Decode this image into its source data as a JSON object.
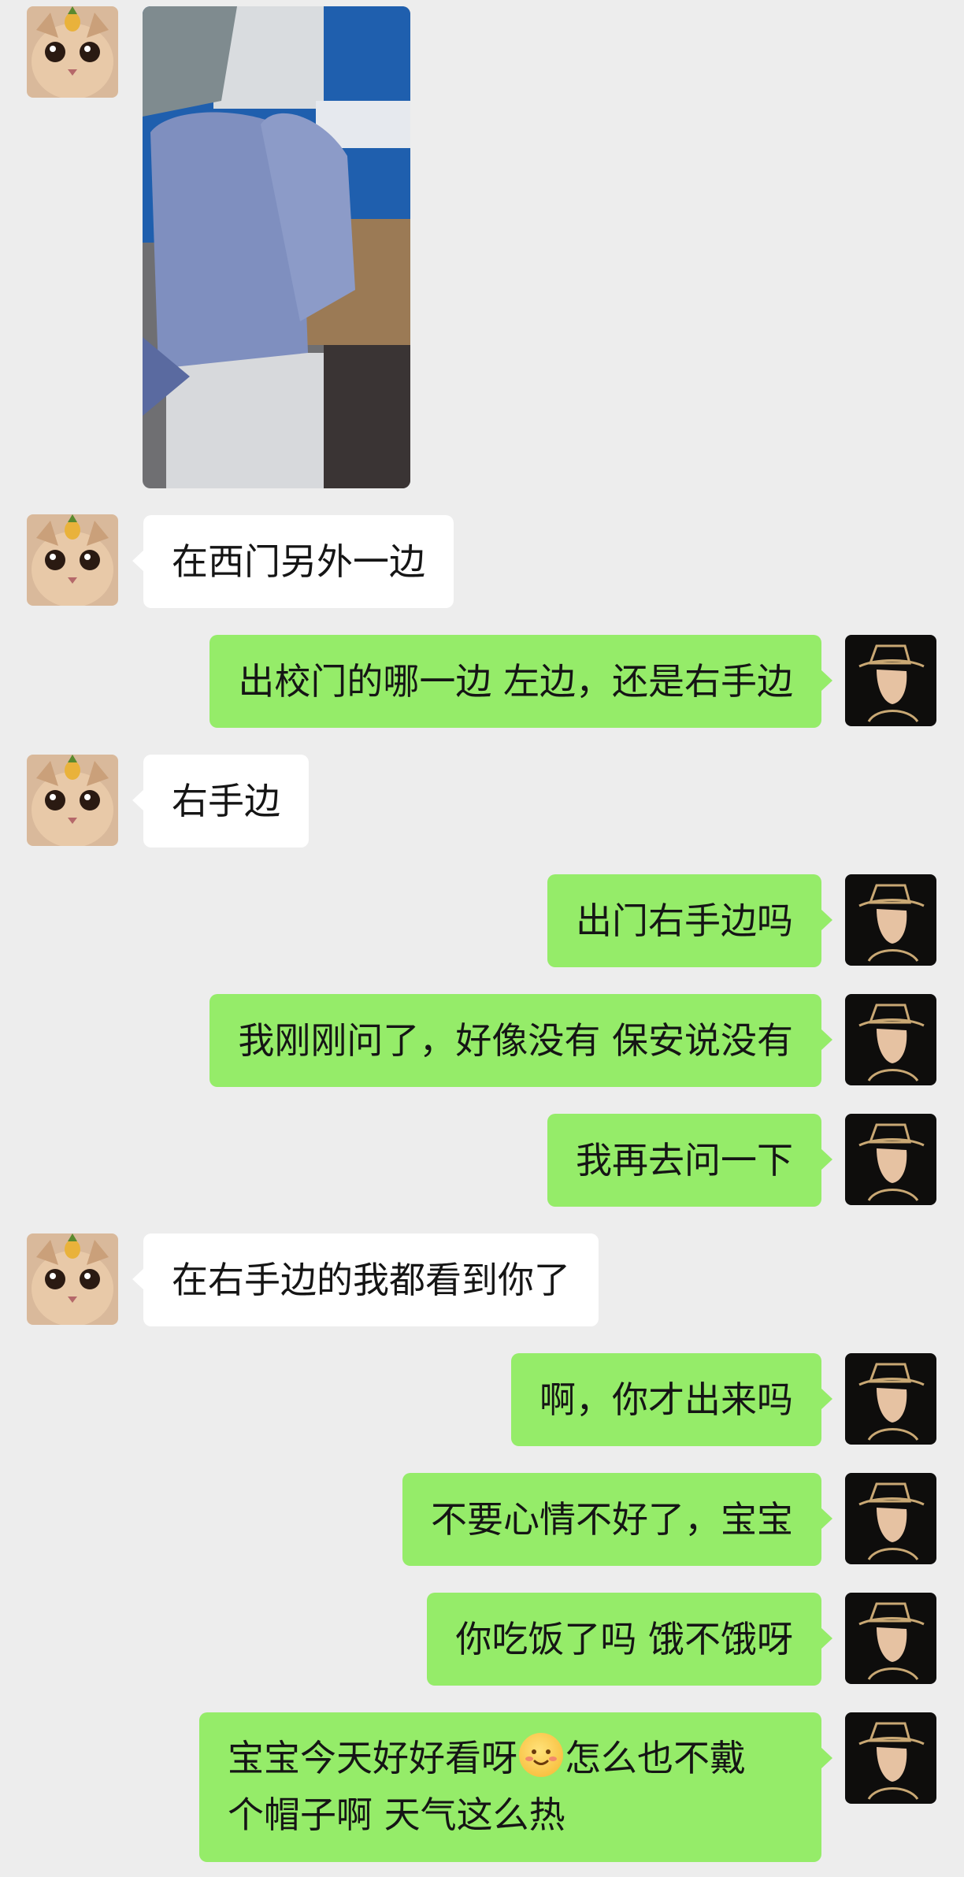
{
  "contacts": {
    "other": {
      "avatar_icon": "cat-with-pineapple-avatar"
    },
    "me": {
      "avatar_icon": "hat-man-sketch-avatar"
    }
  },
  "messages": [
    {
      "side": "left",
      "type": "image",
      "image_icon": "photo-bags-on-stool"
    },
    {
      "side": "left",
      "type": "text",
      "text": "在西门另外一边"
    },
    {
      "side": "right",
      "type": "text",
      "text": "出校门的哪一边 左边，还是右手边"
    },
    {
      "side": "left",
      "type": "text",
      "text": "右手边"
    },
    {
      "side": "right",
      "type": "text",
      "text": "出门右手边吗"
    },
    {
      "side": "right",
      "type": "text",
      "text": "我刚刚问了，好像没有 保安说没有"
    },
    {
      "side": "right",
      "type": "text",
      "text": "我再去问一下"
    },
    {
      "side": "left",
      "type": "text",
      "text": "在右手边的我都看到你了"
    },
    {
      "side": "right",
      "type": "text",
      "text": "啊，你才出来吗"
    },
    {
      "side": "right",
      "type": "text",
      "text": "不要心情不好了，宝宝"
    },
    {
      "side": "right",
      "type": "text",
      "text": "你吃饭了吗 饿不饿呀"
    },
    {
      "side": "right",
      "type": "text",
      "text_part1": "宝宝今天好好看呀",
      "emoji": "smiling-face-emoji",
      "text_part2": "怎么也不戴",
      "text_line2": "个帽子啊 天气这么热"
    }
  ],
  "colors": {
    "background": "#ededed",
    "bubble_self": "#95ec69",
    "bubble_other": "#ffffff"
  }
}
